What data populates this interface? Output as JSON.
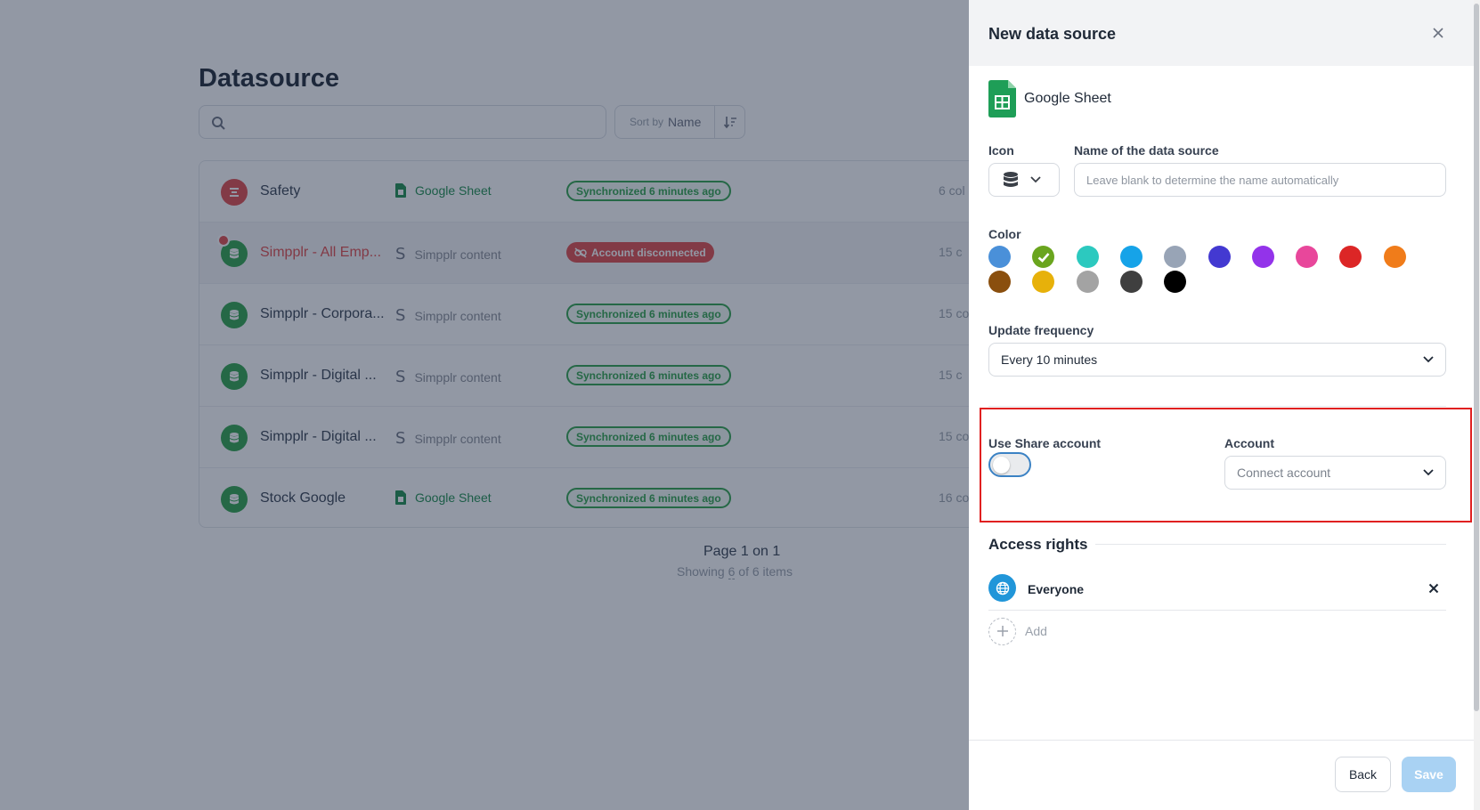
{
  "background": {
    "title": "Datasource",
    "search": {
      "placeholder": ""
    },
    "sort": {
      "label": "Sort by",
      "value": "Name"
    },
    "rows": [
      {
        "name": "Safety",
        "type": "Google Sheet",
        "status": "Synchronized 6 minutes ago",
        "count": "6 col"
      },
      {
        "name": "Simpplr - All Emp...",
        "type": "Simpplr content",
        "status": "Account disconnected",
        "count": "15 c"
      },
      {
        "name": "Simpplr - Corpora...",
        "type": "Simpplr content",
        "status": "Synchronized 6 minutes ago",
        "count": "15 co"
      },
      {
        "name": "Simpplr - Digital ...",
        "type": "Simpplr content",
        "status": "Synchronized 6 minutes ago",
        "count": "15 c"
      },
      {
        "name": "Simpplr - Digital ...",
        "type": "Simpplr content",
        "status": "Synchronized 6 minutes ago",
        "count": "15 col"
      },
      {
        "name": "Stock Google",
        "type": "Google Sheet",
        "status": "Synchronized 6 minutes ago",
        "count": "16 co"
      }
    ],
    "pager": {
      "title": "Page 1 on 1",
      "showing_prefix": "Showing",
      "showing_value": "6",
      "showing_suffix": "of 6 items"
    }
  },
  "panel": {
    "title": "New data source",
    "source_name": "Google Sheet",
    "icon_label": "Icon",
    "icon_value": "database-icon",
    "name_label": "Name of the data source",
    "name_placeholder": "Leave blank to determine the name automatically",
    "name_value": "",
    "color_label": "Color",
    "colors": [
      "#4a90d9",
      "#6aa51e",
      "#2cc9bf",
      "#16a3e8",
      "#98a4b6",
      "#4339d1",
      "#9333ea",
      "#e8479b",
      "#dc2626",
      "#f07c1a",
      "#8a4f0e",
      "#e7b10a",
      "#a3a3a3",
      "#3f3f3f",
      "#000000"
    ],
    "selected_color": "#6aa51e",
    "frequency_label": "Update frequency",
    "frequency_value": "Every 10 minutes",
    "share_label": "Use Share account",
    "share_enabled": false,
    "account_label": "Account",
    "account_value": "Connect account",
    "access_title": "Access rights",
    "access_items": [
      {
        "label": "Everyone",
        "icon": "globe-icon"
      }
    ],
    "add_label": "Add",
    "back_label": "Back",
    "save_label": "Save"
  },
  "colors": {
    "accent": "#2196d9",
    "status_ok": "#2fa34b",
    "status_bad": "#e14b4b",
    "highlight": "#e02020",
    "save_disabled": "#a9d2f3"
  }
}
